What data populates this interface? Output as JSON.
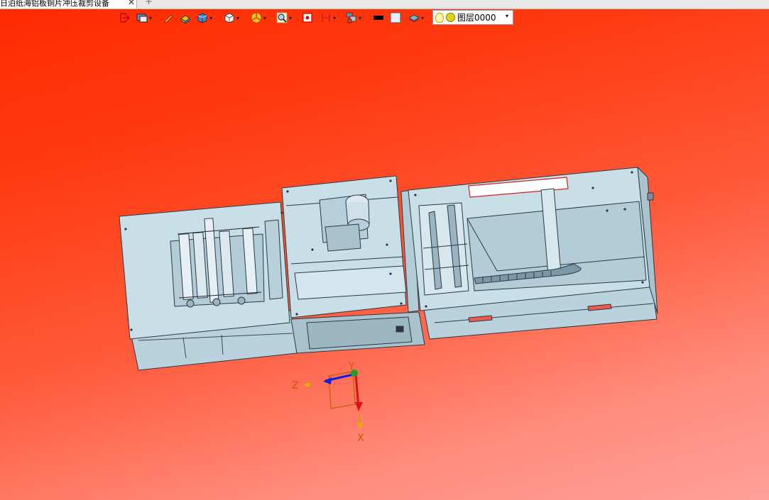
{
  "tabs": [
    {
      "label": "日泊纸海铝板铜片冲压裁剪设备",
      "close_glyph": "✕"
    }
  ],
  "new_tab_glyph": "+",
  "side_mark": "",
  "toolbar": {
    "layer": {
      "label": "图层0000",
      "dropdown_glyph": "▾"
    }
  },
  "axes": {
    "x_label": "X",
    "y_label": "Y",
    "z_label": "Z"
  },
  "colors": {
    "background_top": "#ff2a00",
    "background_bottom": "#ffa09a",
    "model_fill": "#c8dfe8",
    "model_stroke": "#2a3a44",
    "axis_x": "#e01010",
    "axis_y": "#10a010",
    "axis_z": "#1020e0"
  }
}
